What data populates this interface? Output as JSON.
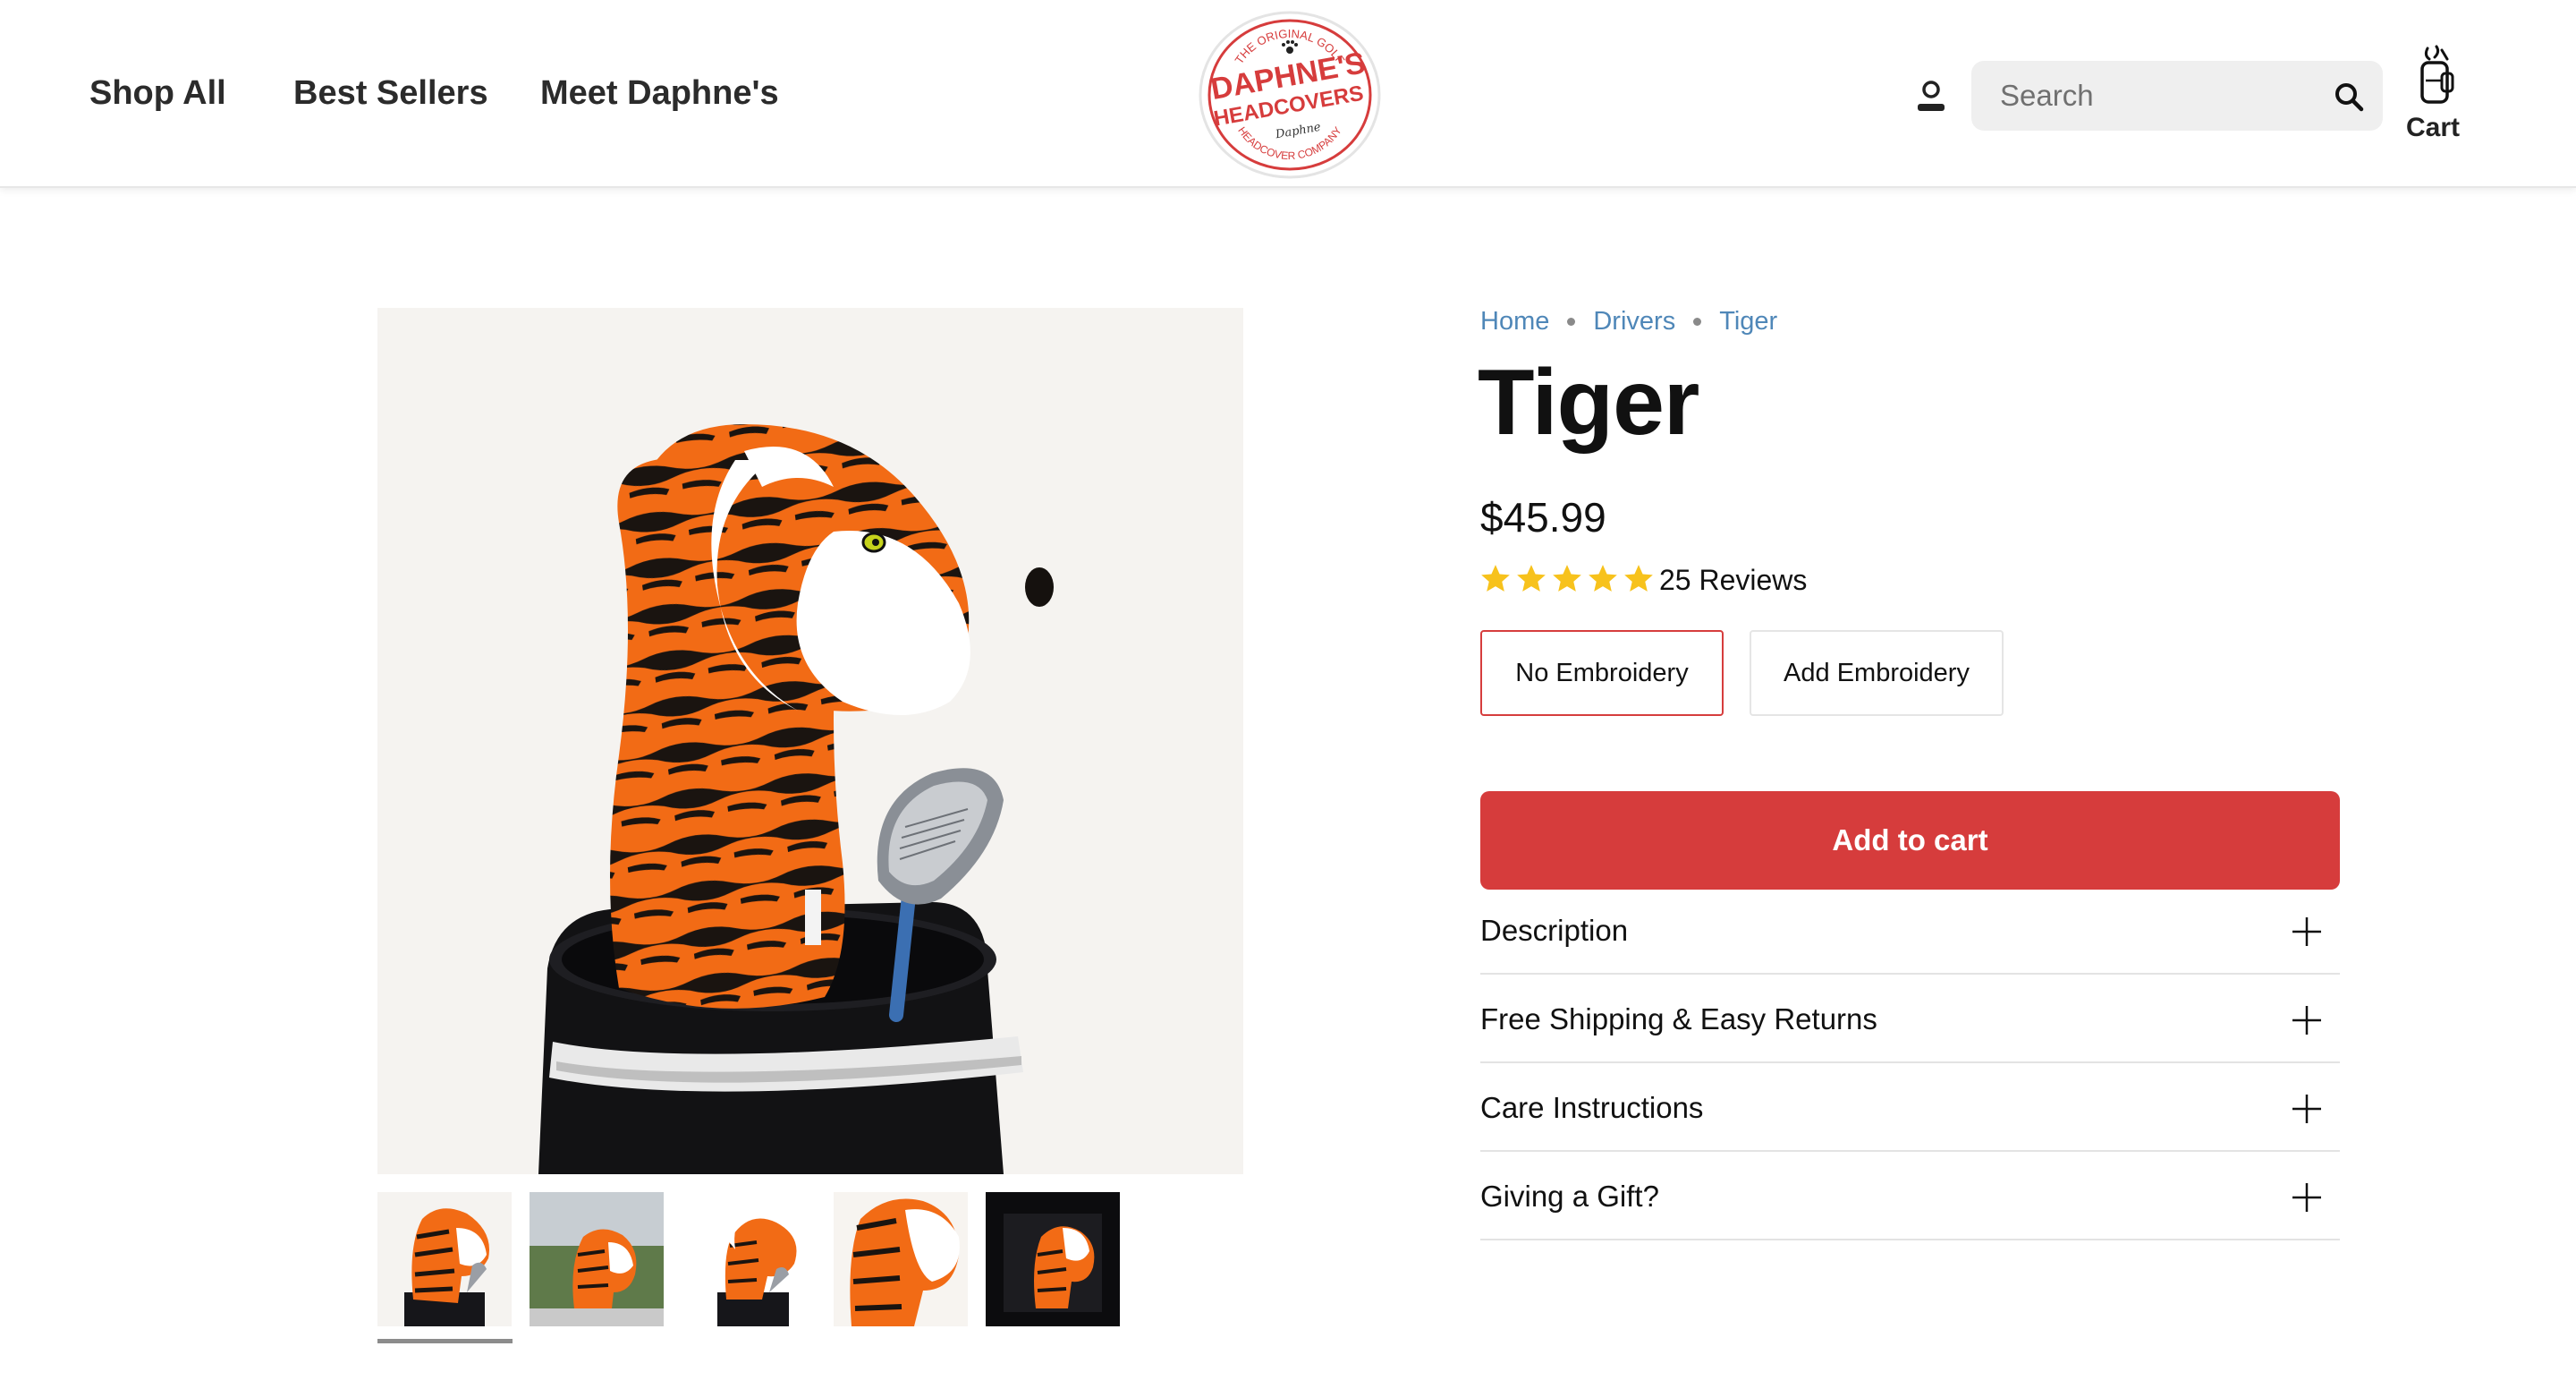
{
  "header": {
    "nav": [
      {
        "label": "Shop All"
      },
      {
        "label": "Best Sellers"
      },
      {
        "label": "Meet Daphne's"
      }
    ],
    "logo": {
      "top_text": "THE ORIGINAL GOLF",
      "name_line1": "DAPHNE'S",
      "name_line2": "HEADCOVERS",
      "signature": "Daphne",
      "bottom_text": "HEADCOVER COMPANY",
      "brand_color": "#d63c3c"
    },
    "search": {
      "placeholder": "Search"
    },
    "cart": {
      "label": "Cart"
    }
  },
  "gallery": {
    "thumbnails": [
      "tiger-front",
      "tiger-outdoor",
      "tiger-side",
      "tiger-closeup",
      "tiger-dark"
    ],
    "selected_index": 0
  },
  "product": {
    "breadcrumb": [
      "Home",
      "Drivers",
      "Tiger"
    ],
    "title": "Tiger",
    "price": "$45.99",
    "rating": 5,
    "reviews": "25 Reviews",
    "options": [
      {
        "label": "No Embroidery",
        "selected": true
      },
      {
        "label": "Add Embroidery",
        "selected": false
      }
    ],
    "add_to_cart": "Add to cart",
    "accordion": [
      {
        "label": "Description"
      },
      {
        "label": "Free Shipping & Easy Returns"
      },
      {
        "label": "Care Instructions"
      },
      {
        "label": "Giving a Gift?"
      }
    ]
  },
  "colors": {
    "accent_red": "#d63c3c",
    "breadcrumb_blue": "#4f87b8",
    "star_yellow": "#f7c21c"
  }
}
